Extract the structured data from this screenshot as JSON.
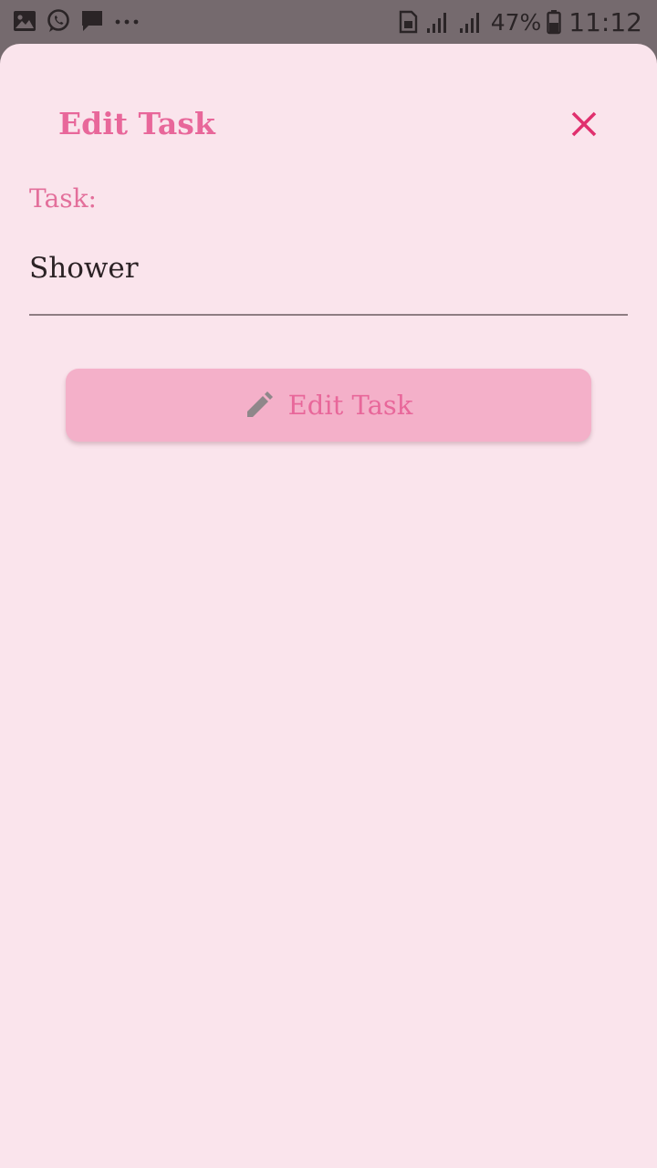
{
  "status_bar": {
    "icons_left": [
      "gallery-icon",
      "whatsapp-icon",
      "message-icon",
      "more-dots-icon"
    ],
    "icons_right": [
      "sim-icon",
      "signal-icon",
      "signal-icon",
      "battery-icon"
    ],
    "battery_percent": "47%",
    "time": "11:12"
  },
  "dialog": {
    "title": "Edit Task",
    "close_icon": "close-icon",
    "field_label": "Task:",
    "task_value": "Shower",
    "task_placeholder": "",
    "submit_label": "Edit Task",
    "submit_icon": "pencil-icon"
  },
  "colors": {
    "accent": "#e8679a",
    "close": "#e0306e",
    "sheet_background": "#fae4ec",
    "button_background": "#f4b0c9",
    "status_bar": "#756a6e"
  }
}
